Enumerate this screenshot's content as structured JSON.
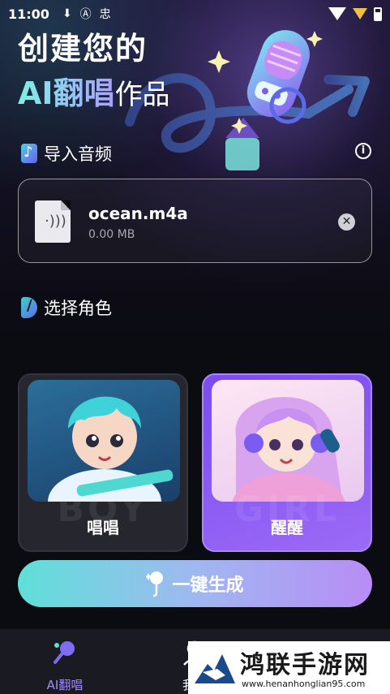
{
  "status_bar": {
    "time": "11:00",
    "icons": [
      "download-icon",
      "a-icon",
      "signal-app-icon"
    ]
  },
  "headline": {
    "line1": "创建您的",
    "line2_accent": "AI翻唱",
    "line2_rest": "作品"
  },
  "import_section": {
    "title": "导入音频",
    "file": {
      "name": "ocean.m4a",
      "size": "0.00 MB"
    }
  },
  "role_section": {
    "title": "选择角色",
    "roles": [
      {
        "label": "唱唱",
        "watermark": "BOY",
        "selected": false
      },
      {
        "label": "醒醒",
        "watermark": "GIRL",
        "selected": true
      }
    ]
  },
  "generate_button": {
    "label": "一键生成"
  },
  "tabbar": {
    "tabs": [
      {
        "label": "AI翻唱",
        "active": true
      },
      {
        "label": "我的",
        "active": false
      }
    ]
  },
  "watermark": {
    "name": "鸿联手游网",
    "url": "www.henanhonglian95.com"
  },
  "colors": {
    "accent": "#9f8bff",
    "selected_card": "#7b4bf0",
    "button_gradient_start": "#5fe0d8",
    "button_gradient_end": "#b88cf5"
  }
}
